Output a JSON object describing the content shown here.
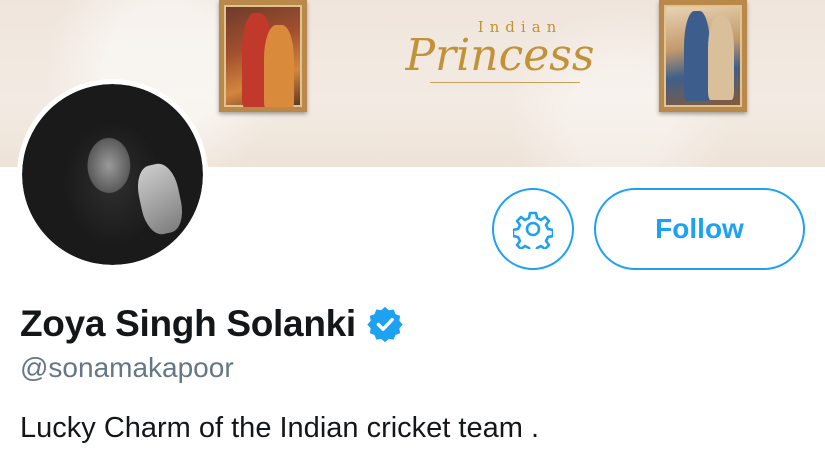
{
  "banner": {
    "logo_small": "Indian",
    "logo_big": "Princess"
  },
  "profile": {
    "display_name": "Zoya Singh Solanki",
    "handle": "@sonamakapoor",
    "bio": "Lucky Charm of the Indian cricket team .",
    "verified": true
  },
  "actions": {
    "settings_icon": "gear-icon",
    "follow_label": "Follow"
  },
  "colors": {
    "accent": "#1da1f2",
    "name": "#14171a",
    "handle": "#657786"
  }
}
